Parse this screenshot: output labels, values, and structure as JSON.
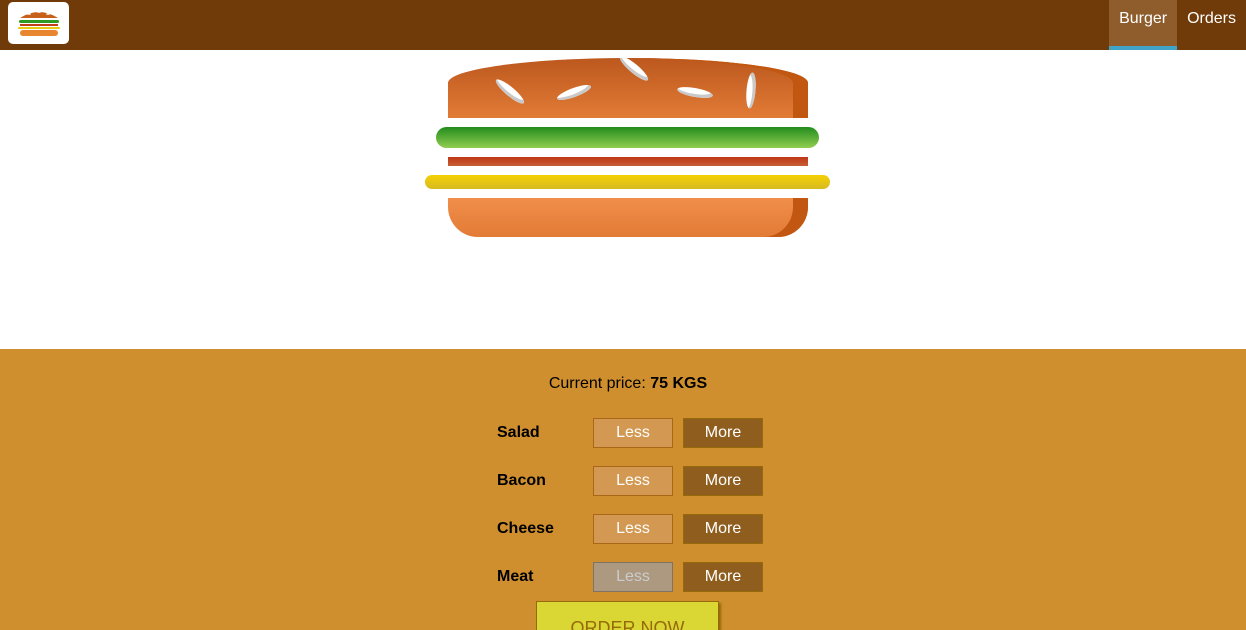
{
  "header": {
    "logo_icon": "burger-logo-icon",
    "nav": [
      {
        "label": "Burger",
        "active": true
      },
      {
        "label": "Orders",
        "active": false
      }
    ]
  },
  "burger": {
    "layers": [
      "bun-top",
      "salad",
      "bacon",
      "cheese",
      "bun-bottom"
    ]
  },
  "controls": {
    "price_label": "Current price:",
    "price_value": "75 KGS",
    "ingredients": [
      {
        "label": "Salad",
        "less_label": "Less",
        "more_label": "More",
        "less_disabled": false
      },
      {
        "label": "Bacon",
        "less_label": "Less",
        "more_label": "More",
        "less_disabled": false
      },
      {
        "label": "Cheese",
        "less_label": "Less",
        "more_label": "More",
        "less_disabled": false
      },
      {
        "label": "Meat",
        "less_label": "Less",
        "more_label": "More",
        "less_disabled": true
      }
    ],
    "order_label": "ORDER NOW"
  },
  "colors": {
    "toolbar": "#703b09",
    "controls_bg": "#cf8f2e",
    "active_nav_underline": "#40a4c8",
    "order_button": "#dad735"
  }
}
